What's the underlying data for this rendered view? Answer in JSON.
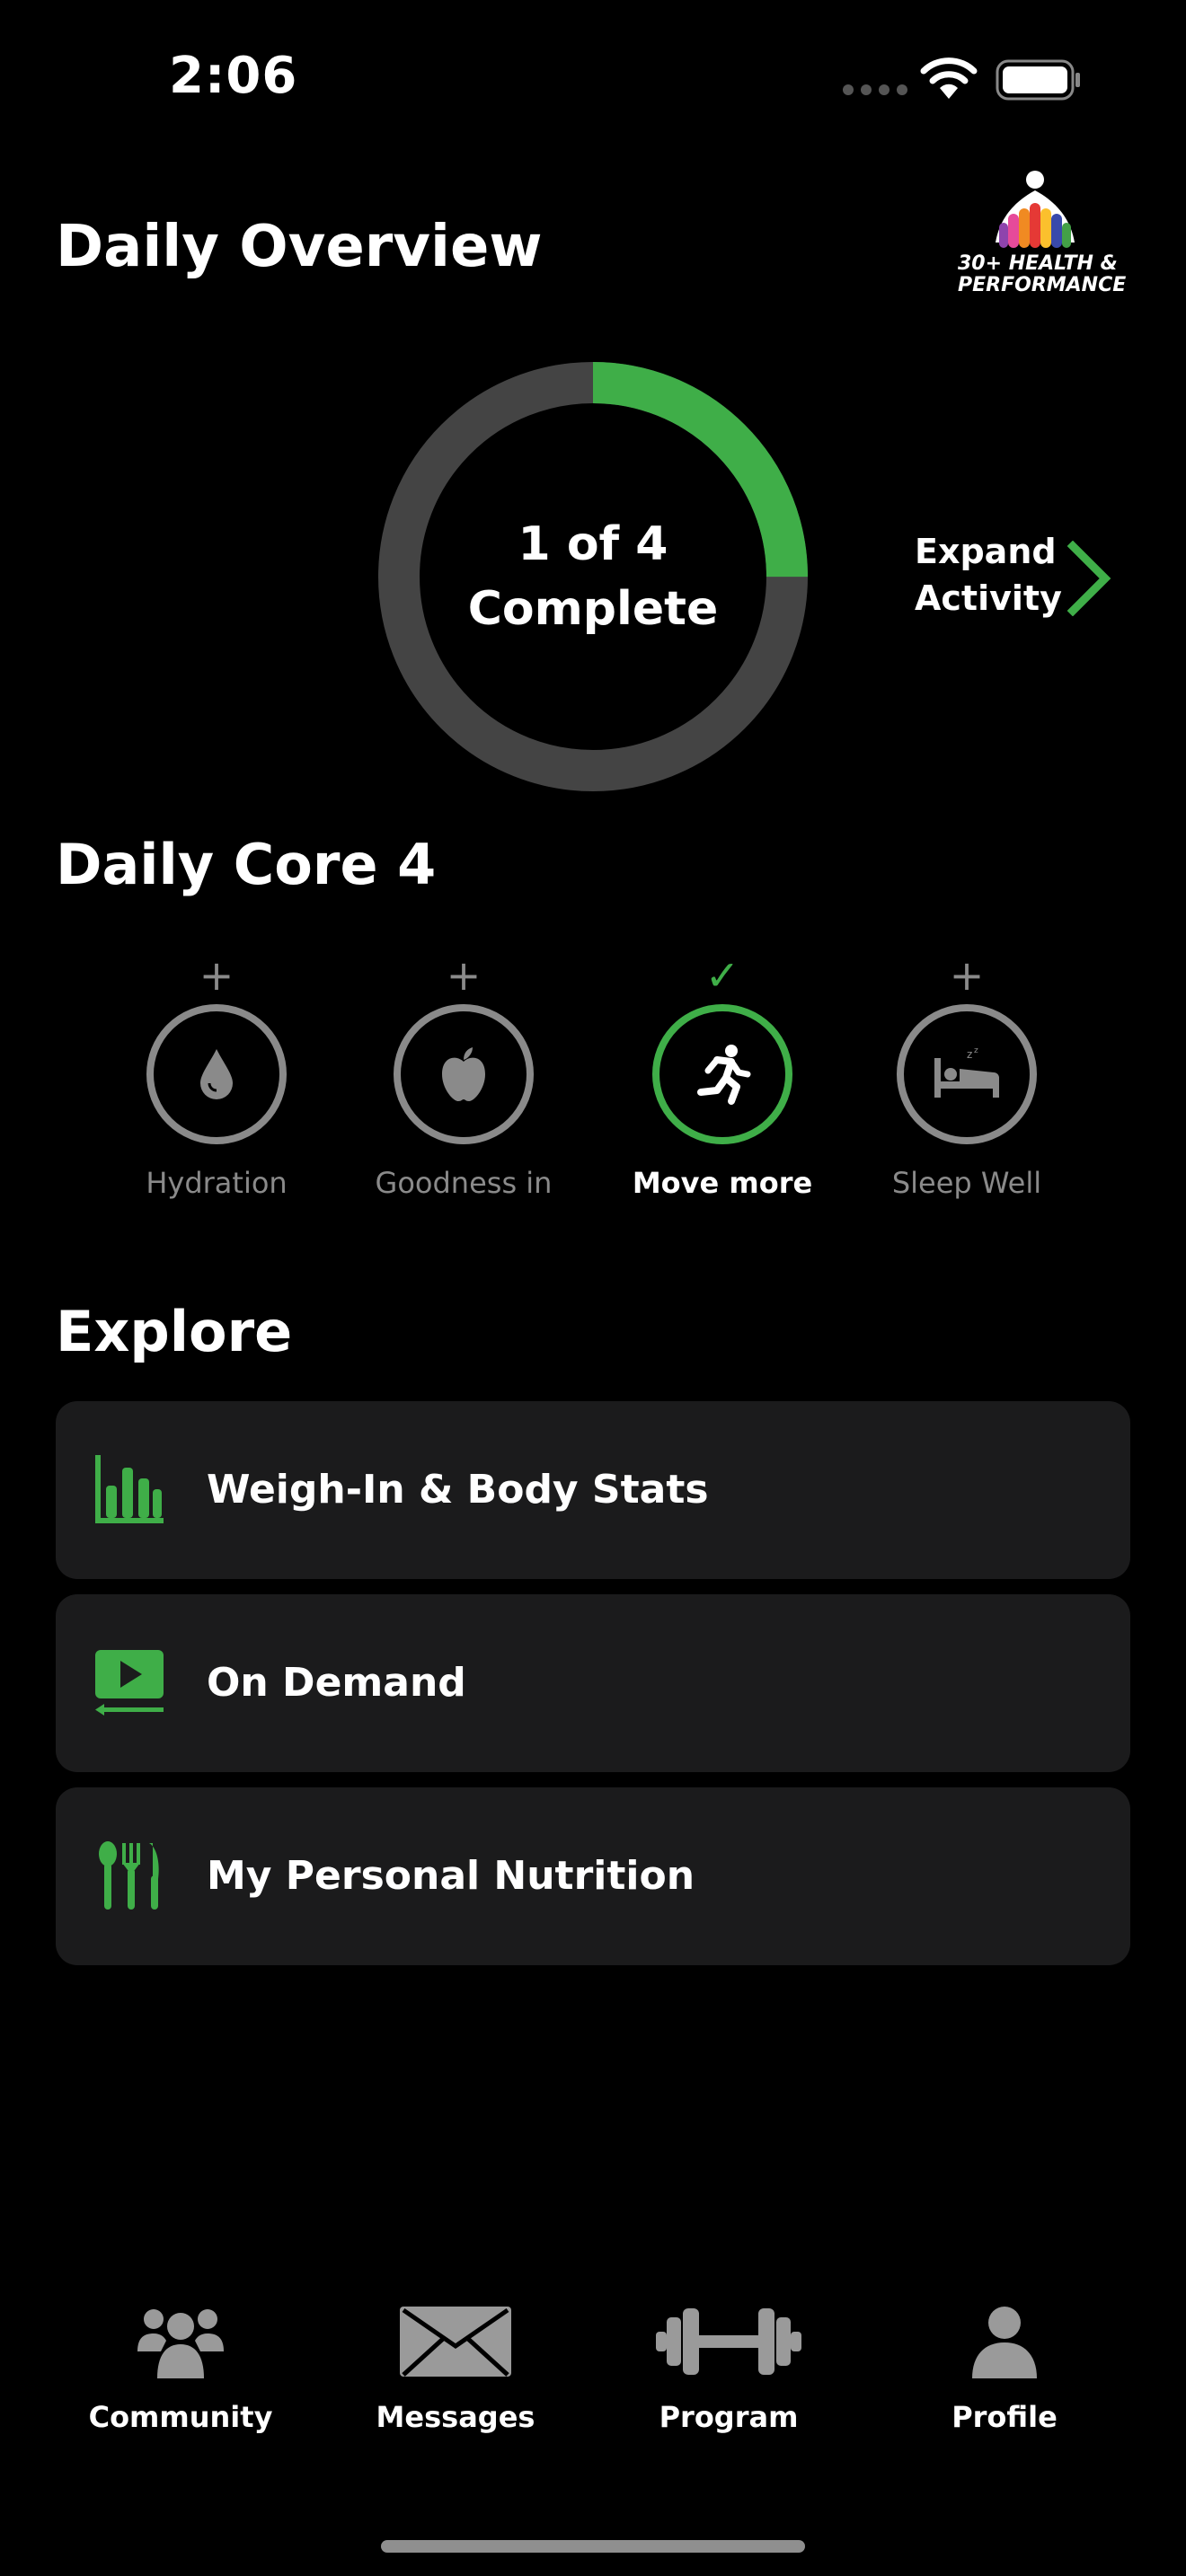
{
  "status_bar": {
    "time": "2:06"
  },
  "header": {
    "title": "Daily Overview",
    "logo_text_line1": "30+ HEALTH &",
    "logo_text_line2": "PERFORMANCE"
  },
  "progress": {
    "completed": 1,
    "total": 4,
    "line1": "1 of 4",
    "line2": "Complete",
    "fraction": 0.25
  },
  "expand": {
    "line1": "Expand",
    "line2": "Activity"
  },
  "core4": {
    "title": "Daily Core 4",
    "items": [
      {
        "label": "Hydration",
        "icon": "water-drop-icon",
        "done": false,
        "mark": "+"
      },
      {
        "label": "Goodness in",
        "icon": "apple-icon",
        "done": false,
        "mark": "+"
      },
      {
        "label": "Move more",
        "icon": "running-person-icon",
        "done": true,
        "mark": "✓"
      },
      {
        "label": "Sleep Well",
        "icon": "bed-sleep-icon",
        "done": false,
        "mark": "+"
      }
    ]
  },
  "explore": {
    "title": "Explore",
    "cards": [
      {
        "label": "Weigh-In & Body Stats",
        "icon": "bar-chart-icon"
      },
      {
        "label": "On Demand",
        "icon": "video-play-icon"
      },
      {
        "label": "My Personal Nutrition",
        "icon": "cutlery-icon"
      }
    ]
  },
  "tabbar": {
    "items": [
      {
        "label": "Community",
        "icon": "group-icon"
      },
      {
        "label": "Messages",
        "icon": "envelope-icon"
      },
      {
        "label": "Program",
        "icon": "dumbbell-icon"
      },
      {
        "label": "Profile",
        "icon": "person-icon"
      }
    ]
  },
  "colors": {
    "accent": "#3fae48",
    "ring_track": "#444444",
    "inactive": "#8a8a8a",
    "card_bg": "#1b1b1c",
    "tab_icon": "#9a9a9a"
  }
}
